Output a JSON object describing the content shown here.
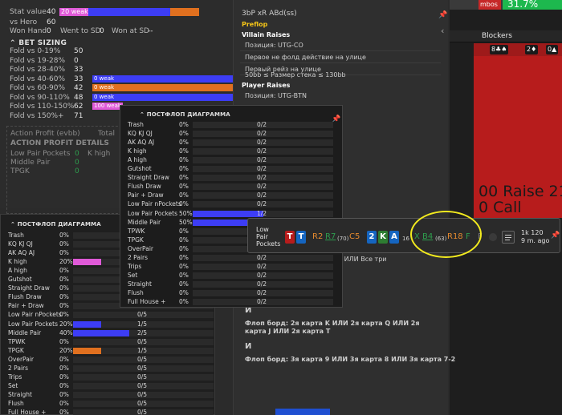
{
  "bg_app": {
    "tab_red": "mbos",
    "tab_green": "31.7%",
    "blockers_label": "Blockers",
    "cards": [
      "8♣♠",
      "2♦",
      "0▲"
    ],
    "raise_text": "00 Raise 21",
    "call_text": "0 Call"
  },
  "left": {
    "stat_value_label": "Stat value",
    "stat_value": "40",
    "stat_weak": "20 weak",
    "vs_hero_label": "vs Hero",
    "vs_hero": "60",
    "won_hand_label": "Won Hand",
    "won_hand": "0",
    "went_sd_label": "Went to SD",
    "went_sd": "0",
    "won_sd_label": "Won at SD",
    "won_sd": "--",
    "bet_sizing_title": "BET SIZING",
    "bet_rows": [
      {
        "label": "Fold vs 0-19%",
        "value": "50",
        "bar": "",
        "color": ""
      },
      {
        "label": "Fold vs 19-28%",
        "value": "0",
        "bar": "",
        "color": ""
      },
      {
        "label": "Fold vs 28-40%",
        "value": "33",
        "bar": "",
        "color": ""
      },
      {
        "label": "Fold vs 40-60%",
        "value": "33",
        "bar": "0 weak",
        "color": "#3d3df5"
      },
      {
        "label": "Fold vs 60-90%",
        "value": "42",
        "bar": "0 weak",
        "color": "#e0701f"
      },
      {
        "label": "Fold vs 90-110%",
        "value": "48",
        "bar": "0 weak",
        "color": "#3d3df5"
      },
      {
        "label": "Fold vs 110-150%",
        "value": "62",
        "bar": "100 weak",
        "color": "#e05ad8"
      },
      {
        "label": "Fold vs 150%+",
        "value": "71",
        "bar": "",
        "color": ""
      }
    ],
    "action_profit": "Action Profit (evbb)",
    "total": "Total",
    "ap_details_title": "ACTION PROFIT DETAILS",
    "ap_rows": [
      {
        "label": "Low Pair Pockets",
        "v1": "0",
        "label2": "K high",
        "v2": "0"
      },
      {
        "label": "Middle Pair",
        "v1": "0",
        "label2": "",
        "v2": ""
      },
      {
        "label": "TPGK",
        "v1": "0",
        "label2": "",
        "v2": ""
      }
    ]
  },
  "mid": {
    "title": "3bP xR ABd(ss)",
    "preflop": "Preflop",
    "villain_raises": "Villain Raises",
    "v_lines": [
      "Позиция: UTG-CO",
      "Первое не фолд действие на улице",
      "Первый рейз на улице",
      "50bb ≤ Размер стека ≤ 130bb"
    ],
    "player_raises": "Player Raises",
    "p_lines": [
      "Позиция: UTG-BTN"
    ],
    "snippet_1": "динаковой масти ИЛИ Все три",
    "and_1": "И",
    "flop_1": "Флоп борд: 2я карта K ИЛИ 2я карта Q ИЛИ 2я карта J ИЛИ 2я карта T",
    "and_2": "И",
    "flop_2": "Флоп борд: 3я карта 9 ИЛИ 3я карта 8 ИЛИ 3я карта 7-2"
  },
  "popup": {
    "title": "ПОСТФЛОП ДИАГРАММА",
    "rows": [
      {
        "name": "Trash",
        "pct": "0%",
        "fill": 0,
        "frac": "0/2",
        "color": "#3d3df5"
      },
      {
        "name": "KQ KJ QJ",
        "pct": "0%",
        "fill": 0,
        "frac": "0/2",
        "color": "#3d3df5"
      },
      {
        "name": "AK AQ AJ",
        "pct": "0%",
        "fill": 0,
        "frac": "0/2",
        "color": "#3d3df5"
      },
      {
        "name": "K high",
        "pct": "0%",
        "fill": 0,
        "frac": "0/2",
        "color": "#3d3df5"
      },
      {
        "name": "A high",
        "pct": "0%",
        "fill": 0,
        "frac": "0/2",
        "color": "#3d3df5"
      },
      {
        "name": "Gutshot",
        "pct": "0%",
        "fill": 0,
        "frac": "0/2",
        "color": "#3d3df5"
      },
      {
        "name": "Straight Draw",
        "pct": "0%",
        "fill": 0,
        "frac": "0/2",
        "color": "#3d3df5"
      },
      {
        "name": "Flush Draw",
        "pct": "0%",
        "fill": 0,
        "frac": "0/2",
        "color": "#3d3df5"
      },
      {
        "name": "Pair + Draw",
        "pct": "0%",
        "fill": 0,
        "frac": "0/2",
        "color": "#3d3df5"
      },
      {
        "name": "Low Pair nPockets",
        "pct": "0%",
        "fill": 0,
        "frac": "0/2",
        "color": "#3d3df5"
      },
      {
        "name": "Low Pair Pockets",
        "pct": "50%",
        "fill": 0.5,
        "frac": "1/2",
        "color": "#3d3df5"
      },
      {
        "name": "Middle Pair",
        "pct": "50%",
        "fill": 0.5,
        "frac": "1/2",
        "color": "#3d3df5"
      },
      {
        "name": "TPWK",
        "pct": "0%",
        "fill": 0,
        "frac": "0/2",
        "color": "#3d3df5"
      },
      {
        "name": "TPGK",
        "pct": "0%",
        "fill": 0,
        "frac": "0/2",
        "color": "#3d3df5"
      },
      {
        "name": "OverPair",
        "pct": "0%",
        "fill": 0,
        "frac": "0/2",
        "color": "#3d3df5"
      },
      {
        "name": "2 Pairs",
        "pct": "0%",
        "fill": 0,
        "frac": "0/2",
        "color": "#3d3df5"
      },
      {
        "name": "Trips",
        "pct": "0%",
        "fill": 0,
        "frac": "0/2",
        "color": "#3d3df5"
      },
      {
        "name": "Set",
        "pct": "0%",
        "fill": 0,
        "frac": "0/2",
        "color": "#3d3df5"
      },
      {
        "name": "Straight",
        "pct": "0%",
        "fill": 0,
        "frac": "0/2",
        "color": "#3d3df5"
      },
      {
        "name": "Flush",
        "pct": "0%",
        "fill": 0,
        "frac": "0/2",
        "color": "#3d3df5"
      },
      {
        "name": "Full House +",
        "pct": "0%",
        "fill": 0,
        "frac": "0/2",
        "color": "#3d3df5"
      }
    ]
  },
  "bottom_table": {
    "title": "ПОСТФЛОП ДИАГРАММА",
    "rows": [
      {
        "name": "Trash",
        "pct": "0%",
        "fill": 0,
        "frac": "",
        "color": "#3d3df5"
      },
      {
        "name": "KQ KJ QJ",
        "pct": "0%",
        "fill": 0,
        "frac": "",
        "color": "#3d3df5"
      },
      {
        "name": "AK AQ AJ",
        "pct": "0%",
        "fill": 0,
        "frac": "",
        "color": "#3d3df5"
      },
      {
        "name": "K high",
        "pct": "20%",
        "fill": 0.2,
        "frac": "",
        "color": "#e05ad8"
      },
      {
        "name": "A high",
        "pct": "0%",
        "fill": 0,
        "frac": "",
        "color": "#3d3df5"
      },
      {
        "name": "Gutshot",
        "pct": "0%",
        "fill": 0,
        "frac": "",
        "color": "#3d3df5"
      },
      {
        "name": "Straight Draw",
        "pct": "0%",
        "fill": 0,
        "frac": "",
        "color": "#3d3df5"
      },
      {
        "name": "Flush Draw",
        "pct": "0%",
        "fill": 0,
        "frac": "",
        "color": "#3d3df5"
      },
      {
        "name": "Pair + Draw",
        "pct": "0%",
        "fill": 0,
        "frac": "",
        "color": "#3d3df5"
      },
      {
        "name": "Low Pair nPockets",
        "pct": "0%",
        "fill": 0,
        "frac": "0/5",
        "color": "#3d3df5"
      },
      {
        "name": "Low Pair Pockets",
        "pct": "20%",
        "fill": 0.2,
        "frac": "1/5",
        "color": "#3d3df5"
      },
      {
        "name": "Middle Pair",
        "pct": "40%",
        "fill": 0.4,
        "frac": "2/5",
        "color": "#3d3df5"
      },
      {
        "name": "TPWK",
        "pct": "0%",
        "fill": 0,
        "frac": "0/5",
        "color": "#3d3df5"
      },
      {
        "name": "TPGK",
        "pct": "20%",
        "fill": 0.2,
        "frac": "1/5",
        "color": "#e0701f"
      },
      {
        "name": "OverPair",
        "pct": "0%",
        "fill": 0,
        "frac": "0/5",
        "color": "#3d3df5"
      },
      {
        "name": "2 Pairs",
        "pct": "0%",
        "fill": 0,
        "frac": "0/5",
        "color": "#3d3df5"
      },
      {
        "name": "Trips",
        "pct": "0%",
        "fill": 0,
        "frac": "0/5",
        "color": "#3d3df5"
      },
      {
        "name": "Set",
        "pct": "0%",
        "fill": 0,
        "frac": "0/5",
        "color": "#3d3df5"
      },
      {
        "name": "Straight",
        "pct": "0%",
        "fill": 0,
        "frac": "0/5",
        "color": "#3d3df5"
      },
      {
        "name": "Flush",
        "pct": "0%",
        "fill": 0,
        "frac": "0/5",
        "color": "#3d3df5"
      },
      {
        "name": "Full House +",
        "pct": "0%",
        "fill": 0,
        "frac": "0/5",
        "color": "#3d3df5"
      }
    ]
  },
  "tooltip": {
    "category_line1": "Low",
    "category_line2": "Pair",
    "category_line3": "Pockets",
    "hole_cards": [
      {
        "rank": "T",
        "color": "#b71c1c"
      },
      {
        "rank": "T",
        "color": "#1565c0"
      }
    ],
    "preflop_actions": [
      {
        "text": "R2",
        "color": "#e58a2e"
      },
      {
        "text": "R7",
        "color": "#2e9d4e"
      },
      {
        "text": "(70)",
        "color": "#cfcfcf"
      },
      {
        "text": "C5",
        "color": "#e58a2e"
      }
    ],
    "board": [
      {
        "rank": "2",
        "color": "#1565c0"
      },
      {
        "rank": "K",
        "color": "#2e7d32"
      },
      {
        "rank": "A",
        "color": "#1565c0"
      }
    ],
    "board_count": "16",
    "flop_actions": [
      {
        "text": "X",
        "color": "#2e9d4e"
      },
      {
        "text": "B4",
        "color": "#2e9d4e"
      },
      {
        "text": "(63)",
        "color": "#cfcfcf"
      },
      {
        "text": "R18",
        "color": "#e58a2e"
      },
      {
        "text": "F",
        "color": "#2e9d4e"
      }
    ],
    "extra": "F",
    "stakes": "1k 120",
    "time_ago": "9 m. ago"
  }
}
